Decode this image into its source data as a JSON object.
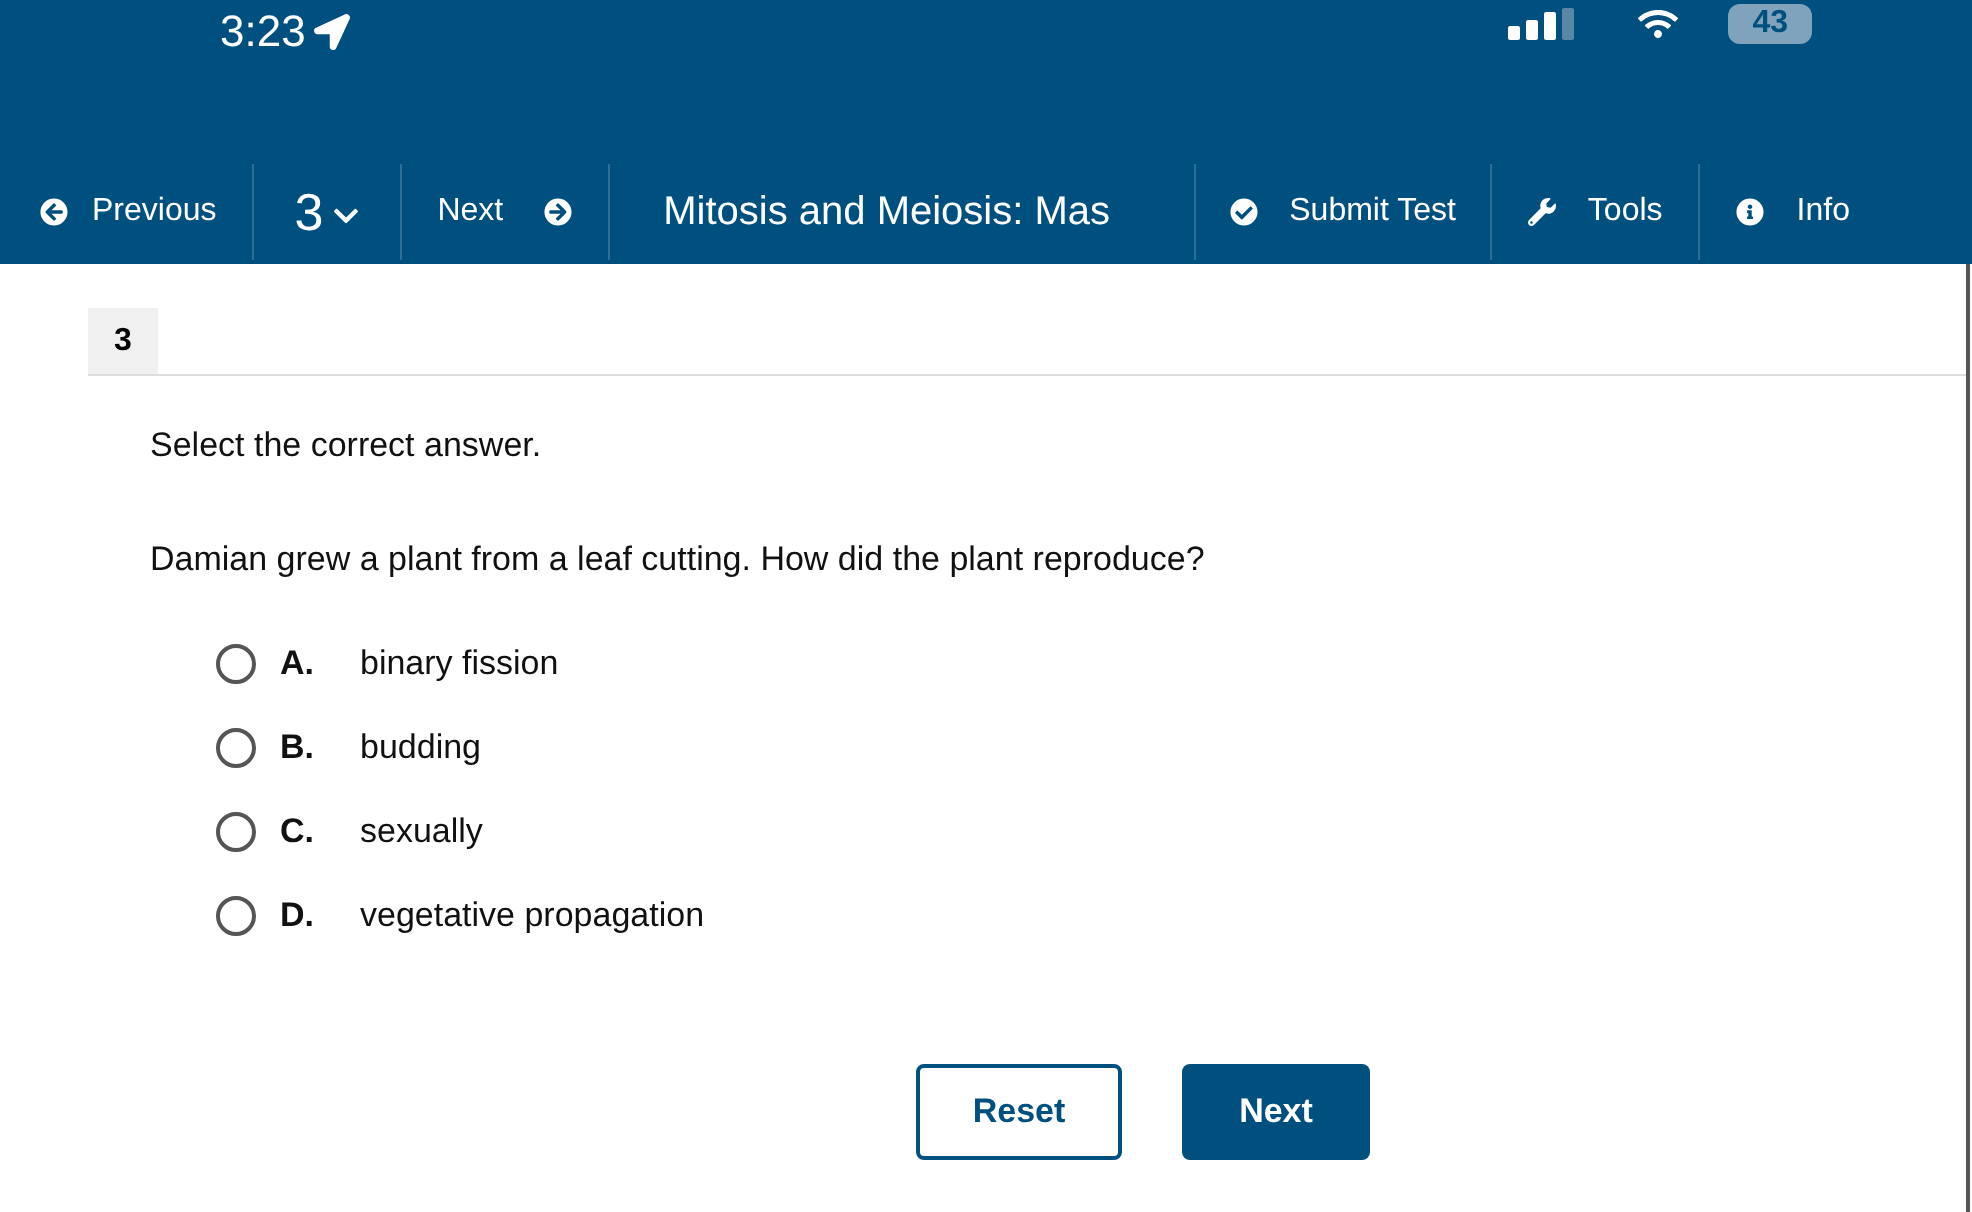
{
  "status_bar": {
    "time": "3:23",
    "battery": "43"
  },
  "toolbar": {
    "previous": "Previous",
    "question_number": "3",
    "next": "Next",
    "title": "Mitosis and Meiosis: Mas",
    "submit": "Submit Test",
    "tools": "Tools",
    "info": "Info"
  },
  "question": {
    "number": "3",
    "instruction": "Select the correct answer.",
    "prompt": "Damian grew a plant from a leaf cutting. How did the plant reproduce?",
    "options": [
      {
        "letter": "A.",
        "text": "binary fission",
        "selected": false
      },
      {
        "letter": "B.",
        "text": "budding",
        "selected": false
      },
      {
        "letter": "C.",
        "text": "sexually",
        "selected": false
      },
      {
        "letter": "D.",
        "text": "vegetative propagation",
        "selected": false
      }
    ]
  },
  "buttons": {
    "reset": "Reset",
    "next": "Next"
  }
}
